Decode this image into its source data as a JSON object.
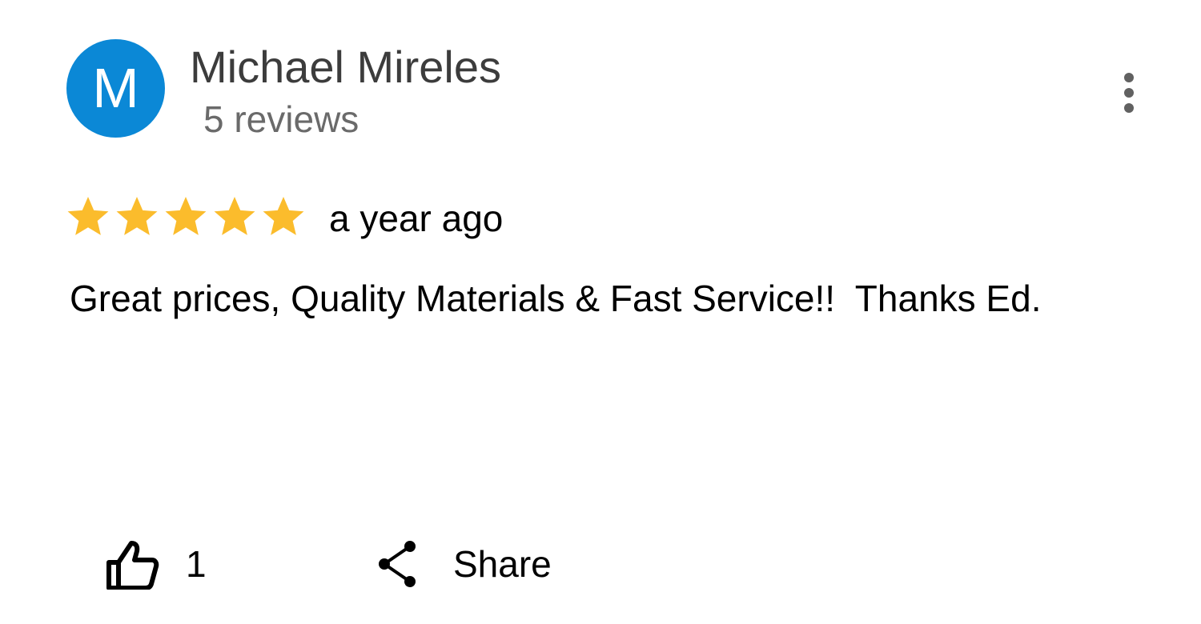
{
  "reviewer": {
    "initial": "M",
    "name": "Michael Mireles",
    "review_count": "5 reviews",
    "avatar_color": "#0b88d6"
  },
  "menu": {
    "icon": "more-vertical-icon"
  },
  "review": {
    "rating": 5,
    "max_rating": 5,
    "star_color": "#fbbc2c",
    "time": "a year ago",
    "text": "Great prices, Quality Materials & Fast Service!!  Thanks Ed."
  },
  "actions": {
    "like_icon": "thumbs-up-icon",
    "like_count": "1",
    "share_icon": "share-icon",
    "share_label": "Share"
  }
}
